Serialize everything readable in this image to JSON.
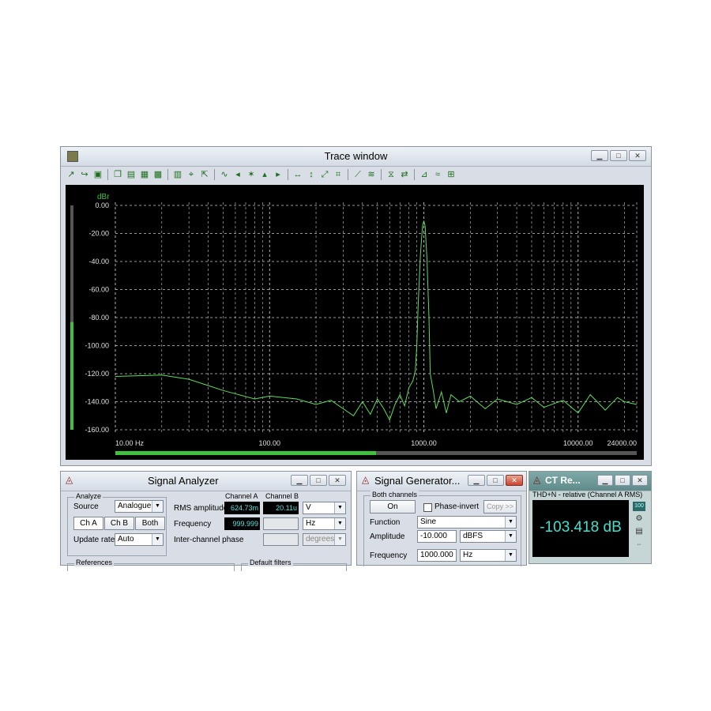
{
  "trace_window": {
    "title": "Trace window",
    "unit_label": "dBr",
    "y_ticks": [
      "0.00",
      "-20.00",
      "-40.00",
      "-60.00",
      "-80.00",
      "-100.00",
      "-120.00",
      "-140.00",
      "-160.00"
    ],
    "x_ticks": [
      "10.00 Hz",
      "100.00",
      "1000.00",
      "10000.00",
      "24000.00"
    ],
    "scroll_fraction": 0.5,
    "level_fraction": 0.48,
    "toolbar_icons": [
      "trace-add-icon",
      "trace-edit-icon",
      "save-icon",
      "copy-icon",
      "print-icon",
      "export-icon",
      "settings-icon",
      "grid-icon",
      "marker-icon",
      "marker-move-icon",
      "trace-shape-icon",
      "cursor-left-icon",
      "cursor-peak-icon",
      "cursor-up-icon",
      "cursor-right-icon",
      "zoom-x-icon",
      "zoom-y-icon",
      "zoom-fit-icon",
      "zoom-box-icon",
      "line-icon",
      "harmonic-icon",
      "filter-icon",
      "swap-icon",
      "reference-icon",
      "overlay-icon",
      "fft-icon"
    ]
  },
  "chart_data": {
    "type": "line",
    "title": "",
    "xlabel": "",
    "ylabel": "dBr",
    "xscale": "log",
    "xlim": [
      10,
      24000
    ],
    "ylim": [
      -160,
      0
    ],
    "grid": true,
    "series": [
      {
        "color": "#5ddc5d",
        "x": [
          10,
          20,
          30,
          50,
          80,
          100,
          150,
          200,
          250,
          300,
          350,
          400,
          450,
          500,
          550,
          600,
          650,
          700,
          750,
          800,
          850,
          880,
          900,
          920,
          950,
          980,
          1000,
          1020,
          1050,
          1080,
          1100,
          1150,
          1200,
          1300,
          1400,
          1500,
          1700,
          2000,
          2500,
          3000,
          4000,
          5000,
          6000,
          8000,
          10000,
          12000,
          15000,
          18000,
          20000,
          24000
        ],
        "y": [
          -122,
          -121,
          -124,
          -132,
          -138,
          -136,
          -138,
          -142,
          -139,
          -145,
          -150,
          -140,
          -149,
          -138,
          -145,
          -153,
          -142,
          -135,
          -143,
          -130,
          -125,
          -118,
          -100,
          -70,
          -35,
          -15,
          -11,
          -15,
          -40,
          -80,
          -120,
          -132,
          -145,
          -133,
          -148,
          -135,
          -140,
          -136,
          -145,
          -138,
          -142,
          -137,
          -144,
          -139,
          -148,
          -135,
          -146,
          -137,
          -140,
          -142
        ]
      }
    ]
  },
  "signal_analyzer": {
    "title": "Signal Analyzer",
    "analyze_group": "Analyze",
    "source_label": "Source",
    "source_value": "Analogue",
    "ch_buttons": [
      "Ch A",
      "Ch B",
      "Both"
    ],
    "update_rate_label": "Update rate",
    "update_rate_value": "Auto",
    "col_a": "Channel A",
    "col_b": "Channel B",
    "rms_label": "RMS amplitude",
    "rms_a": "624.73m",
    "rms_b": "20.11u",
    "rms_unit": "V",
    "freq_label": "Frequency",
    "freq_a": "999.999",
    "freq_unit": "Hz",
    "phase_label": "Inter-channel phase",
    "phase_unit": "degrees",
    "references_group": "References",
    "filters_group": "Default filters"
  },
  "signal_generator": {
    "title": "Signal Generator...",
    "group": "Both channels",
    "on_label": "On",
    "phase_invert_label": "Phase-invert",
    "copy_label": "Copy >>",
    "function_label": "Function",
    "function_value": "Sine",
    "amplitude_label": "Amplitude",
    "amplitude_value": "-10.000",
    "amplitude_unit": "dBFS",
    "frequency_label": "Frequency",
    "frequency_value": "1000.000",
    "frequency_unit": "Hz"
  },
  "ct_reader": {
    "title": "CT Re...",
    "caption": "THD+N - relative (Channel A RMS)",
    "value": "-103.418 dB",
    "side_icons": [
      "range-icon",
      "settings-icon",
      "record-icon",
      "expand-icon"
    ]
  },
  "colors": {
    "trace": "#5ddc5d",
    "readout_text": "#3ee0d0",
    "plot_bg": "#000000"
  }
}
